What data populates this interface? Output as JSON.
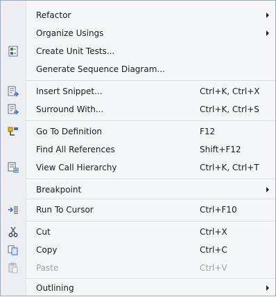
{
  "menu": {
    "items": [
      {
        "label": "Refactor",
        "submenu": true
      },
      {
        "label": "Organize Usings",
        "submenu": true
      },
      {
        "label": "Create Unit Tests...",
        "icon": "unit-test-icon"
      },
      {
        "label": "Generate Sequence Diagram..."
      },
      {
        "label": "Insert Snippet...",
        "shortcut": "Ctrl+K, Ctrl+X",
        "icon": "snippet-icon"
      },
      {
        "label": "Surround With...",
        "shortcut": "Ctrl+K, Ctrl+S",
        "icon": "surround-icon"
      },
      {
        "label": "Go To Definition",
        "shortcut": "F12",
        "icon": "go-to-definition-icon"
      },
      {
        "label": "Find All References",
        "shortcut": "Shift+F12"
      },
      {
        "label": "View Call Hierarchy",
        "shortcut": "Ctrl+K, Ctrl+T",
        "icon": "call-hierarchy-icon"
      },
      {
        "label": "Breakpoint",
        "submenu": true
      },
      {
        "label": "Run To Cursor",
        "shortcut": "Ctrl+F10",
        "icon": "run-to-cursor-icon"
      },
      {
        "label": "Cut",
        "shortcut": "Ctrl+X",
        "icon": "scissors-icon"
      },
      {
        "label": "Copy",
        "shortcut": "Ctrl+C",
        "icon": "copy-icon"
      },
      {
        "label": "Paste",
        "shortcut": "Ctrl+V",
        "icon": "paste-icon",
        "disabled": true
      },
      {
        "label": "Outlining",
        "submenu": true
      }
    ]
  }
}
